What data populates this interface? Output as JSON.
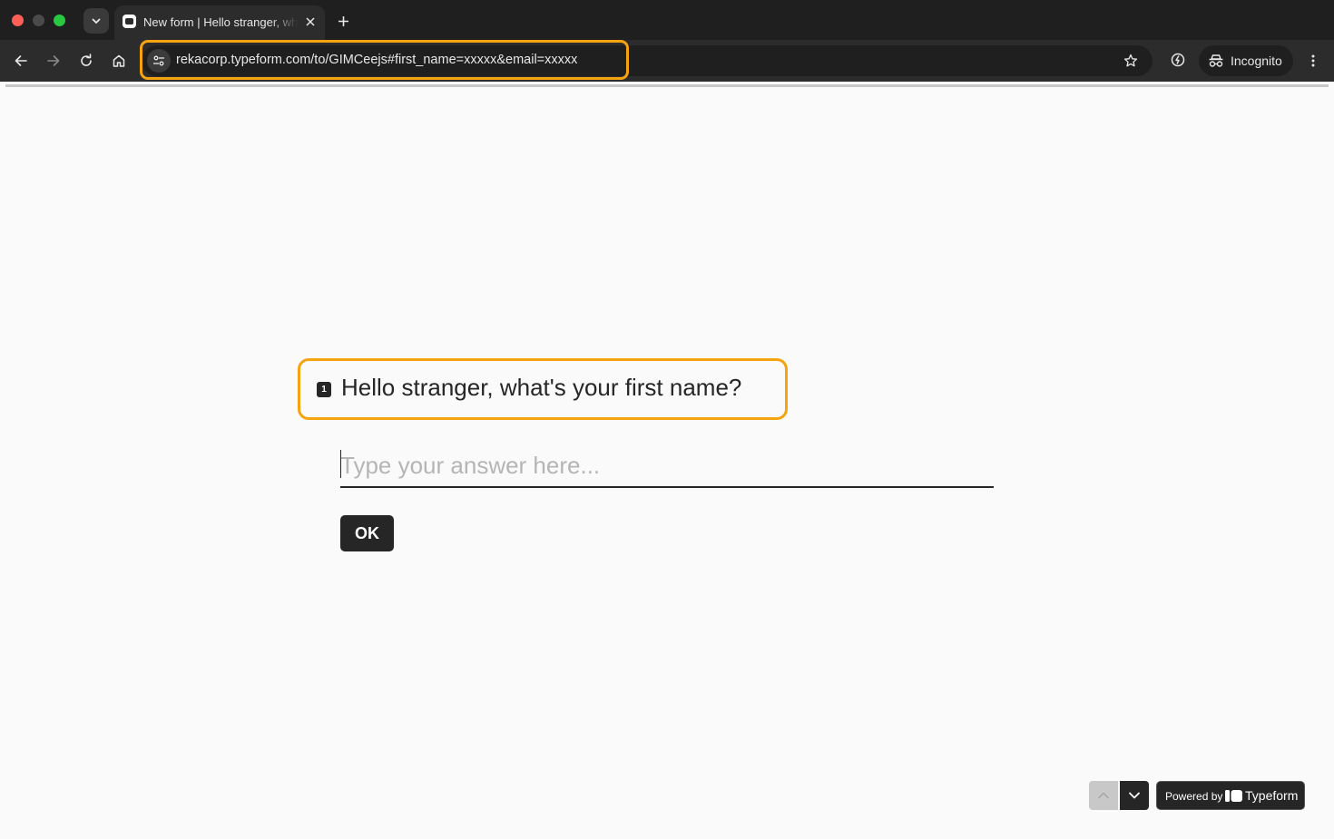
{
  "browser": {
    "tab_title": "New form | Hello stranger, what's your first name?",
    "url": "rekacorp.typeform.com/to/GIMCeejs#first_name=xxxxx&email=xxxxx",
    "profile_label": "Incognito"
  },
  "form": {
    "question_number": "1",
    "question_text": "Hello stranger, what's your first name?",
    "answer_placeholder": "Type your answer here...",
    "answer_value": "",
    "ok_label": "OK",
    "progress_fraction": 0
  },
  "footer": {
    "powered_prefix": "Powered by",
    "powered_brand": "Typeform"
  },
  "colors": {
    "highlight": "#f5a30f",
    "button_bg": "#262626",
    "page_bg": "#fafafa"
  }
}
